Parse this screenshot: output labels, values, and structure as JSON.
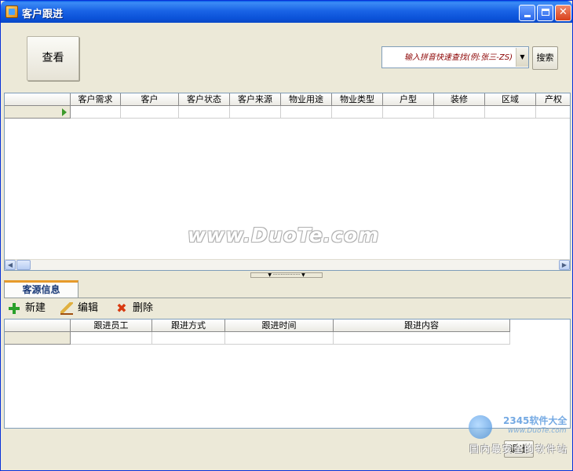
{
  "window": {
    "title": "客户跟进"
  },
  "top": {
    "view_button": "查看"
  },
  "search": {
    "placeholder": "输入拼音快速查找(例:张三-ZS)",
    "button": "搜索"
  },
  "grid1": {
    "columns": [
      "",
      "客户需求",
      "客户",
      "客户状态",
      "客户来源",
      "物业用途",
      "物业类型",
      "户型",
      "装修",
      "区域",
      "产权"
    ]
  },
  "tabs": [
    {
      "label": "客源信息"
    }
  ],
  "toolbar": {
    "new_label": "新建",
    "edit_label": "编辑",
    "delete_label": "删除"
  },
  "grid2": {
    "columns": [
      "",
      "跟进员工",
      "跟进方式",
      "跟进时间",
      "跟进内容"
    ]
  },
  "footer": {
    "exit_button": "退出"
  },
  "watermarks": {
    "center": "www.DuoTe.com",
    "brand": "2345软件大全",
    "url": "www.DuoTe.com",
    "site": "国内最安全的软件站"
  },
  "colors": {
    "titlebar": "#0b52d8",
    "window_bg": "#ece9d8",
    "tab_accent": "#e69a2a",
    "row_arrow": "#3c9a2a"
  }
}
